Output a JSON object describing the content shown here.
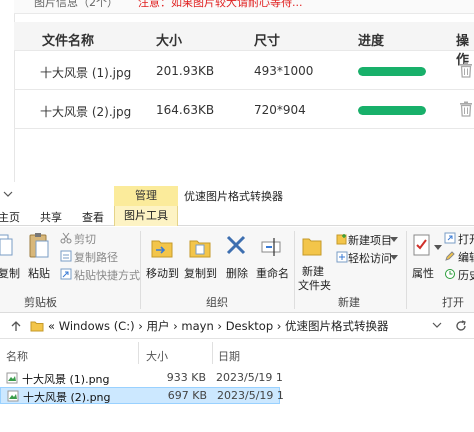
{
  "web": {
    "top_label": "图片信息（2个）",
    "top_warning": "注意：如果图片较大请耐心等待...",
    "headers": [
      "文件名称",
      "大小",
      "尺寸",
      "进度",
      "操作"
    ],
    "rows": [
      {
        "name": "十大风景 (1).jpg",
        "size": "201.93KB",
        "dims": "493*1000",
        "progress": 1.0,
        "action_icon": "trash-icon"
      },
      {
        "name": "十大风景 (2).jpg",
        "size": "164.63KB",
        "dims": "720*904",
        "progress": 1.0,
        "action_icon": "trash-icon"
      }
    ],
    "progress_color": "#18b06a"
  },
  "explorer": {
    "context_header": "管理",
    "window_title": "优速图片格式转换器",
    "tabs": [
      "主页",
      "共享",
      "查看",
      "图片工具"
    ],
    "ribbon": {
      "clipboard": {
        "copy": "复制",
        "paste": "粘贴",
        "cut": "剪切",
        "copy_path": "复制路径",
        "paste_shortcut": "粘贴快捷方式",
        "group": "剪贴板"
      },
      "organize": {
        "move_to": "移动到",
        "copy_to": "复制到",
        "delete": "删除",
        "rename": "重命名",
        "group": "组织"
      },
      "new": {
        "new_folder_line1": "新建",
        "new_folder_line2": "文件夹",
        "new_item": "新建项目",
        "easy_access": "轻松访问",
        "group": "新建"
      },
      "open": {
        "properties": "属性",
        "open": "打开",
        "edit": "编辑",
        "history": "历史",
        "group": "打开"
      }
    },
    "address": {
      "segments": [
        "«",
        "Windows (C:)",
        "›",
        "用户",
        "›",
        "mayn",
        "›",
        "Desktop",
        "›",
        "优速图片格式转换器"
      ]
    },
    "columns": [
      "名称",
      "大小",
      "日期"
    ],
    "files": [
      {
        "name": "十大风景 (1).png",
        "size": "933 KB",
        "date": "2023/5/19 1",
        "selected": false
      },
      {
        "name": "十大风景 (2).png",
        "size": "697 KB",
        "date": "2023/5/19 1",
        "selected": true
      }
    ]
  }
}
